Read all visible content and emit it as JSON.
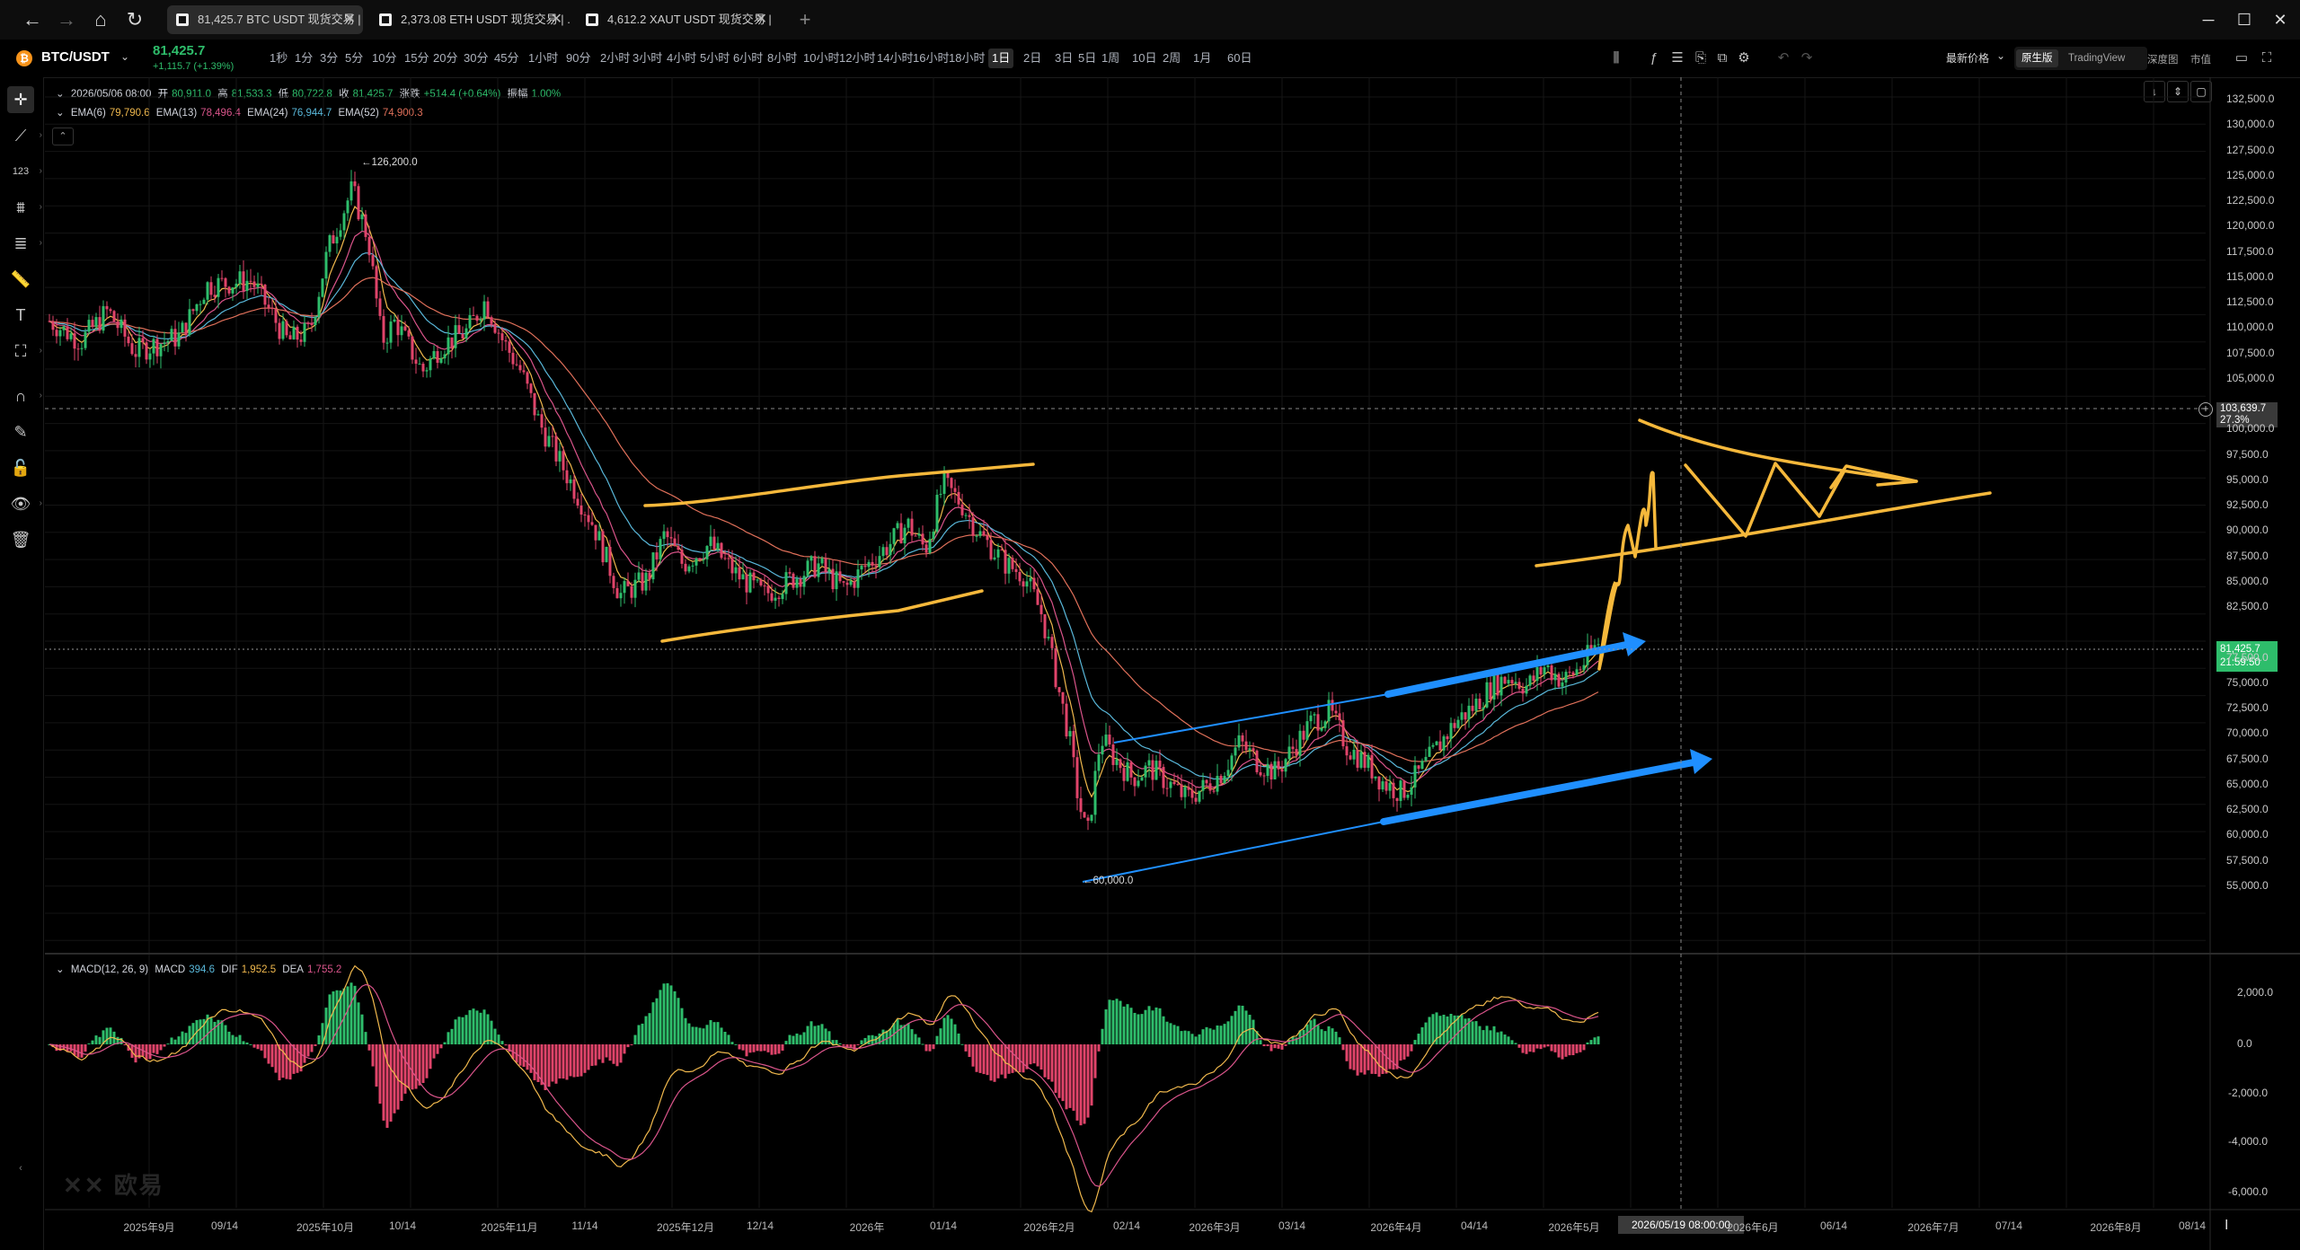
{
  "browser": {
    "tabs": [
      {
        "label": "81,425.7 BTC USDT 现货交易 | O...",
        "active": true
      },
      {
        "label": "2,373.08 ETH USDT 现货交易 | ...",
        "active": false
      },
      {
        "label": "4,612.2 XAUT USDT 现货交易 | ...",
        "active": false
      }
    ],
    "new_tab": "+",
    "window": {
      "minimize": "─",
      "maximize": "☐",
      "close": "✕"
    }
  },
  "toolbar": {
    "symbol": "BTC/USDT",
    "price": "81,425.7",
    "change": "+1,115.7 (+1.39%)",
    "intervals": [
      "1秒",
      "1分",
      "3分",
      "5分",
      "10分",
      "15分",
      "20分",
      "30分",
      "45分",
      "1小时",
      "90分",
      "2小时",
      "3小时",
      "4小时",
      "5小时",
      "6小时",
      "8小时",
      "10小时",
      "12小时",
      "14小时",
      "16小时",
      "18小时",
      "1日",
      "2日",
      "3日",
      "5日",
      "1周",
      "10日",
      "2周",
      "1月",
      "60日"
    ],
    "active_interval": "1日",
    "price_type": "最新价格",
    "views": [
      "原生版",
      "TradingView",
      "深度图",
      "市值"
    ],
    "active_view": "原生版"
  },
  "legend": {
    "date": "2026/05/06 08:00",
    "open_label": "开",
    "open": "80,911.0",
    "high_label": "高",
    "high": "81,533.3",
    "low_label": "低",
    "low": "80,722.8",
    "close_label": "收",
    "close": "81,425.7",
    "chg_label": "涨跌",
    "chg": "+514.4 (+0.64%)",
    "amp_label": "振幅",
    "amp": "1.00%",
    "ema": [
      {
        "label": "EMA(6)",
        "value": "79,790.6",
        "color": "#f0b84d"
      },
      {
        "label": "EMA(13)",
        "value": "78,496.4",
        "color": "#d9548a"
      },
      {
        "label": "EMA(24)",
        "value": "76,944.7",
        "color": "#59b7d9"
      },
      {
        "label": "EMA(52)",
        "value": "74,900.3",
        "color": "#e0705a"
      }
    ]
  },
  "annotations": {
    "high_mark": "126,200.0",
    "low_mark": "60,000.0"
  },
  "price_axis": {
    "labels": [
      "132,500.0",
      "130,000.0",
      "127,500.0",
      "125,000.0",
      "122,500.0",
      "120,000.0",
      "117,500.0",
      "115,000.0",
      "112,500.0",
      "110,000.0",
      "107,500.0",
      "105,000.0",
      "100,000.0",
      "97,500.0",
      "95,000.0",
      "92,500.0",
      "90,000.0",
      "87,500.0",
      "85,000.0",
      "82,500.0",
      "77,500.0",
      "75,000.0",
      "72,500.0",
      "70,000.0",
      "67,500.0",
      "65,000.0",
      "62,500.0",
      "60,000.0",
      "57,500.0",
      "55,000.0"
    ],
    "crosshair_price": "103,639.7",
    "crosshair_pct": "27.3%",
    "last_price": "81,425.7",
    "countdown": "21:59:50"
  },
  "macd": {
    "title": "MACD(12, 26, 9)",
    "macd_label": "MACD",
    "macd_value": "394.6",
    "dif_label": "DIF",
    "dif_value": "1,952.5",
    "dea_label": "DEA",
    "dea_value": "1,755.2",
    "axis": [
      "2,000.0",
      "0.0",
      "-2,000.0",
      "-4,000.0",
      "-6,000.0"
    ]
  },
  "time_axis": {
    "labels": [
      "2025年9月",
      "09/14",
      "2025年10月",
      "10/14",
      "2025年11月",
      "11/14",
      "2025年12月",
      "12/14",
      "2026年",
      "01/14",
      "2026年2月",
      "02/14",
      "2026年3月",
      "03/14",
      "2026年4月",
      "04/14",
      "2026年5月",
      "2026年6月",
      "06/14",
      "2026年7月",
      "07/14",
      "2026年8月",
      "08/14"
    ],
    "crosshair_time": "2026/05/19 08:00:00"
  },
  "watermark": "欧易",
  "colors": {
    "up": "#2ebd6b",
    "down": "#e0446a",
    "drawing_yellow": "#f5b83b",
    "drawing_blue": "#1f8fff"
  }
}
